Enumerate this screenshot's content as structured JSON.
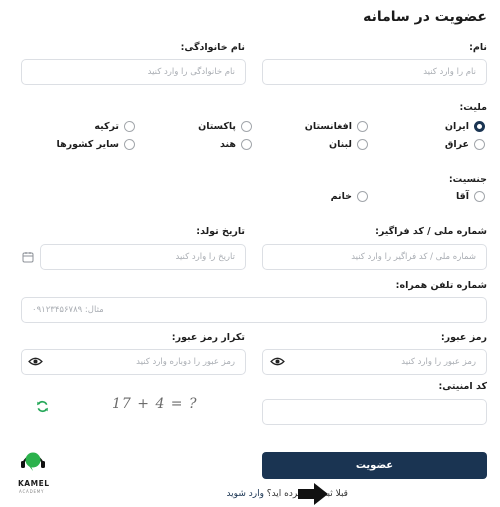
{
  "page_title": "عضویت در سامانه",
  "fields": {
    "first_name": {
      "label": "نام:",
      "placeholder": "نام را وارد کنید"
    },
    "last_name": {
      "label": "نام خانوادگی:",
      "placeholder": "نام خانوادگی را وارد کنید"
    },
    "national_id": {
      "label": "شماره ملی / کد فراگیر:",
      "placeholder": "شماره ملی / کد فراگیر را وارد کنید"
    },
    "birth_date": {
      "label": "تاریخ تولد:",
      "placeholder": "تاریخ را وارد کنید"
    },
    "phone": {
      "label": "شماره تلفن همراه:",
      "placeholder": "مثال: ۰۹۱۲۳۴۵۶۷۸۹"
    },
    "password": {
      "label": "رمز عبور:",
      "placeholder": "رمز عبور را وارد کنید"
    },
    "password_repeat": {
      "label": "تکرار رمز عبور:",
      "placeholder": "رمز عبور را دوباره وارد کنید"
    },
    "captcha": {
      "label": "کد امنیتی:",
      "challenge": "17 + 4 = ?"
    }
  },
  "nationality": {
    "label": "ملیت:",
    "options": [
      "ایران",
      "افغانستان",
      "پاکستان",
      "ترکیه",
      "عراق",
      "لبنان",
      "هند",
      "سایر کشورها"
    ],
    "selected": "ایران"
  },
  "gender": {
    "label": "جنسیت:",
    "options": [
      "آقا",
      "خانم"
    ],
    "selected": ""
  },
  "submit_label": "عضویت",
  "login_prompt": "قبلا ثبت نام کرده اید؟",
  "login_link": "وارد شوید",
  "logo": {
    "line1": "KAMEL",
    "line2": "ACADEMY"
  },
  "colors": {
    "primary": "#1a3452",
    "refresh": "#27a85a",
    "logo_green": "#2bb24c"
  },
  "icons": [
    "calendar-icon",
    "eye-icon",
    "refresh-icon",
    "arrow-right-icon"
  ]
}
